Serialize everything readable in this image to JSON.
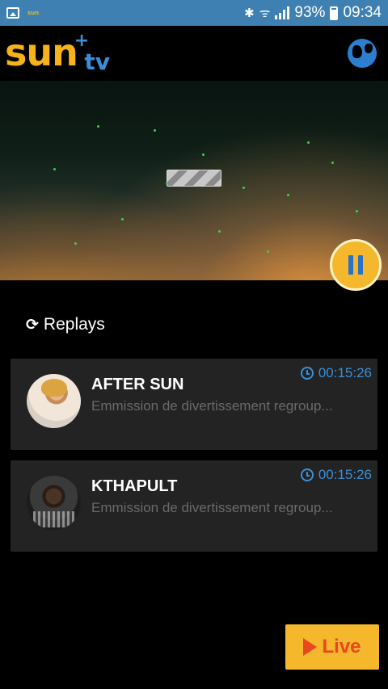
{
  "status_bar": {
    "notification_icons": [
      "image-icon",
      "sun-tv-icon"
    ],
    "app_notification_label": "sun",
    "bluetooth": "✱",
    "wifi": "ᯤ",
    "battery_percent": "93%",
    "time": "09:34"
  },
  "header": {
    "logo_main": "sun",
    "logo_plus": "+",
    "logo_sub": "tv",
    "globe_icon": "globe-icon"
  },
  "player": {
    "state": "playing",
    "pause_icon": "pause-icon"
  },
  "replays": {
    "refresh_glyph": "⟳",
    "label": "Replays"
  },
  "programs": [
    {
      "title": "AFTER SUN",
      "description": "Emmission de divertissement regroup...",
      "duration": "00:15:26"
    },
    {
      "title": "KTHAPULT",
      "description": "Emmission de divertissement regroup...",
      "duration": "00:15:26"
    }
  ],
  "live_button": {
    "label": "Live",
    "icon": "play-icon"
  },
  "colors": {
    "status_bar": "#3f80b3",
    "brand_yellow": "#f5b82c",
    "brand_blue": "#3a8fd8",
    "live_red": "#e8471f",
    "card_bg": "#232323"
  }
}
